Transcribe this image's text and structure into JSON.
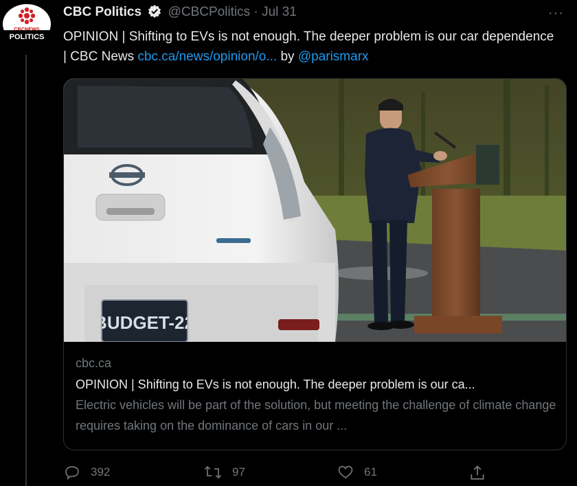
{
  "avatar": {
    "label": "POLITICS",
    "brand_text": "CBCNEWS"
  },
  "header": {
    "name": "CBC Politics",
    "handle": "@CBCPolitics",
    "separator": "·",
    "time": "Jul 31",
    "more": "···"
  },
  "tweet": {
    "text_plain": "OPINION | Shifting to EVs is not enough. The deeper problem is our car dependence | CBC News ",
    "link": "cbc.ca/news/opinion/o...",
    "by": " by ",
    "mention": "@parismarx"
  },
  "card": {
    "plate": "BUDGET-22",
    "domain": "cbc.ca",
    "title": "OPINION | Shifting to EVs is not enough. The deeper problem is our ca...",
    "description": "Electric vehicles will be part of the solution, but meeting the challenge of climate change requires taking on the dominance of cars in our ..."
  },
  "actions": {
    "reply_count": "392",
    "retweet_count": "97",
    "like_count": "61"
  },
  "colors": {
    "background": "#000000",
    "text": "#e7e9ea",
    "muted": "#71767b",
    "link": "#1d9bf0",
    "border": "#2f3336"
  },
  "icons": [
    "verified-icon",
    "more-icon",
    "reply-icon",
    "retweet-icon",
    "like-icon",
    "share-icon"
  ]
}
